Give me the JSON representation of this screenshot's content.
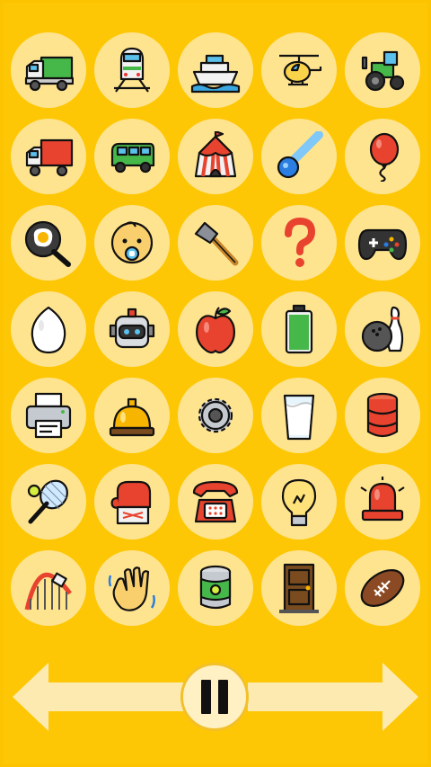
{
  "screen": {
    "title": "",
    "background_color": "#fec705",
    "tile_color": "#ffe490"
  },
  "tiles": [
    {
      "icon": "delivery-truck-icon"
    },
    {
      "icon": "high-speed-train-icon"
    },
    {
      "icon": "passenger-ship-icon"
    },
    {
      "icon": "helicopter-icon"
    },
    {
      "icon": "tractor-icon"
    },
    {
      "icon": "moving-truck-icon"
    },
    {
      "icon": "minibus-icon"
    },
    {
      "icon": "circus-tent-icon"
    },
    {
      "icon": "comet-icon"
    },
    {
      "icon": "balloon-icon"
    },
    {
      "icon": "frying-pan-egg-icon"
    },
    {
      "icon": "baby-icon"
    },
    {
      "icon": "hammer-icon"
    },
    {
      "icon": "question-mark-icon"
    },
    {
      "icon": "game-controller-icon"
    },
    {
      "icon": "egg-icon"
    },
    {
      "icon": "robot-icon"
    },
    {
      "icon": "apple-icon"
    },
    {
      "icon": "battery-icon"
    },
    {
      "icon": "bowling-icon"
    },
    {
      "icon": "printer-icon"
    },
    {
      "icon": "bellhop-bell-icon"
    },
    {
      "icon": "gear-icon"
    },
    {
      "icon": "glass-of-milk-icon"
    },
    {
      "icon": "oil-drum-icon"
    },
    {
      "icon": "tennis-racket-icon"
    },
    {
      "icon": "boxing-glove-icon"
    },
    {
      "icon": "telephone-icon"
    },
    {
      "icon": "light-bulb-icon"
    },
    {
      "icon": "police-light-icon"
    },
    {
      "icon": "roller-coaster-icon"
    },
    {
      "icon": "waving-hand-icon"
    },
    {
      "icon": "canned-food-icon"
    },
    {
      "icon": "door-icon"
    },
    {
      "icon": "american-football-icon"
    }
  ],
  "controls": {
    "left_arrow_icon": "left-arrow-icon",
    "right_arrow_icon": "right-arrow-icon",
    "pause_icon": "pause-icon"
  }
}
